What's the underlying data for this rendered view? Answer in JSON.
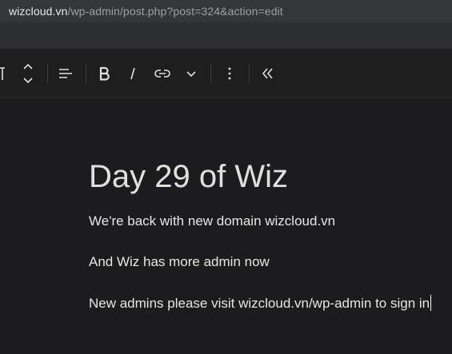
{
  "browser": {
    "url_host": "wizcloud.vn",
    "url_path": "/wp-admin/post.php?post=324&action=edit"
  },
  "toolbar": {
    "icons": [
      "text-icon",
      "move-up-down-icon",
      "align-icon",
      "bold-icon",
      "italic-icon",
      "link-icon",
      "chevron-down-icon",
      "more-options-icon",
      "collapse-icon"
    ]
  },
  "post": {
    "title": "Day 29 of Wiz",
    "paragraphs": [
      "We're back with new domain wizcloud.vn",
      "And Wiz has more admin now",
      "New admins please visit wizcloud.vn/wp-admin to sign in"
    ]
  },
  "colors": {
    "background": "#1c1c1e",
    "urlbar": "#35363a",
    "text": "#e0e0e0"
  }
}
